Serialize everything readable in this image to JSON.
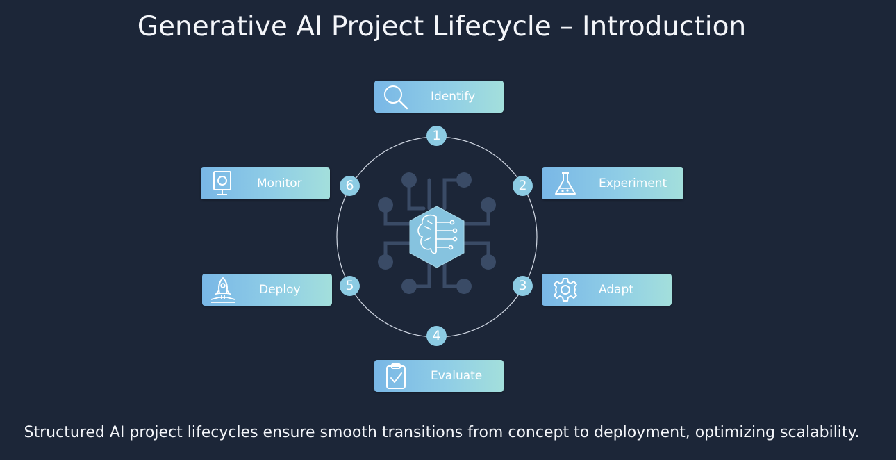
{
  "title": "Generative AI Project Lifecycle – Introduction",
  "caption": "Structured AI project lifecycles ensure smooth transitions from concept to deployment, optimizing scalability.",
  "steps": [
    {
      "number": "1",
      "label": "Identify",
      "icon": "magnifier-icon"
    },
    {
      "number": "2",
      "label": "Experiment",
      "icon": "flask-icon"
    },
    {
      "number": "3",
      "label": "Adapt",
      "icon": "gear-icon"
    },
    {
      "number": "4",
      "label": "Evaluate",
      "icon": "clipboard-check-icon"
    },
    {
      "number": "5",
      "label": "Deploy",
      "icon": "rocket-icon"
    },
    {
      "number": "6",
      "label": "Monitor",
      "icon": "monitor-icon"
    }
  ],
  "center": {
    "icon": "ai-brain-circuit-icon"
  },
  "colors": {
    "background": "#1c2638",
    "box_gradient_start": "#79b7e6",
    "box_gradient_end": "#a3dfdc",
    "badge": "#8ccbe3",
    "circuit": "#3a4b66"
  }
}
